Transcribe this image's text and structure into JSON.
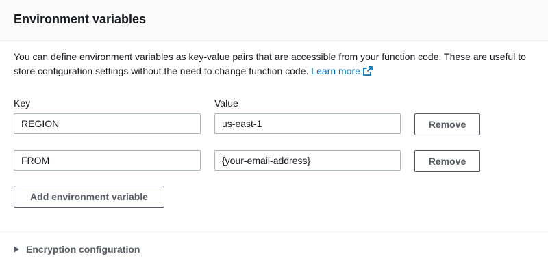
{
  "section": {
    "title": "Environment variables",
    "description": "You can define environment variables as key-value pairs that are accessible from your function code. These are useful to store configuration settings without the need to change function code.",
    "learn_more": "Learn more"
  },
  "columns": {
    "key": "Key",
    "value": "Value"
  },
  "variables": [
    {
      "key": "REGION",
      "value": "us-east-1",
      "remove": "Remove"
    },
    {
      "key": "FROM",
      "value": "{your-email-address}",
      "remove": "Remove"
    }
  ],
  "add_button": "Add environment variable",
  "encryption": {
    "label": "Encryption configuration",
    "icon": "caret-right-icon"
  },
  "colors": {
    "link": "#0073bb",
    "border": "#aab7b8",
    "button_text": "#545b64"
  }
}
